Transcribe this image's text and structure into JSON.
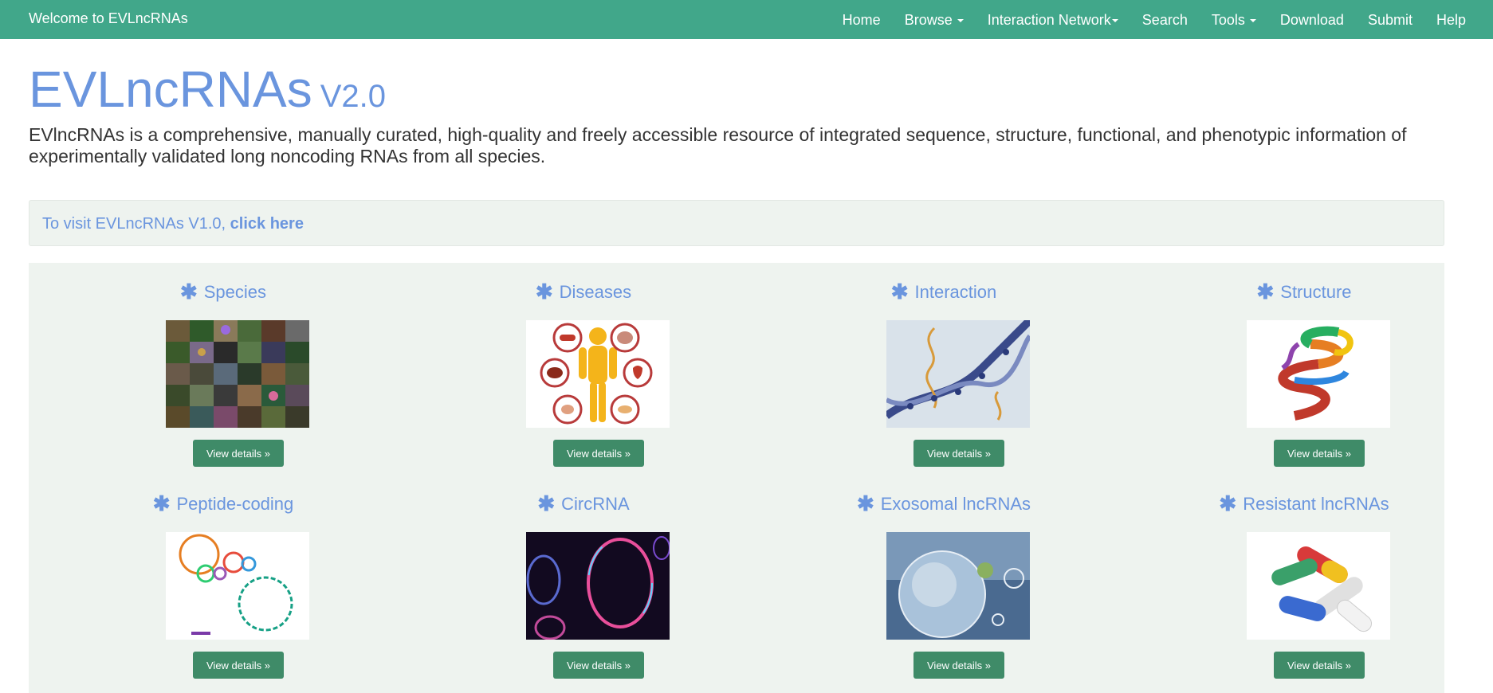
{
  "navbar": {
    "brand": "Welcome to EVLncRNAs",
    "items": [
      {
        "label": "Home"
      },
      {
        "label": "Browse"
      },
      {
        "label": "Interaction Network"
      },
      {
        "label": "Search"
      },
      {
        "label": "Tools"
      },
      {
        "label": "Download"
      },
      {
        "label": "Submit"
      },
      {
        "label": "Help"
      }
    ]
  },
  "header": {
    "title": "EVLncRNAs",
    "version": "V2.0",
    "description": "EVlncRNAs is a comprehensive, manually curated, high-quality and freely accessible resource of integrated sequence, structure, functional, and phenotypic information of experimentally validated long noncoding RNAs from all species."
  },
  "notice": {
    "prefix": "To visit EVLncRNAs V1.0, ",
    "link": "click here"
  },
  "categories": [
    {
      "title": "Species",
      "button": "View details »"
    },
    {
      "title": "Diseases",
      "button": "View details »"
    },
    {
      "title": "Interaction",
      "button": "View details »"
    },
    {
      "title": "Structure",
      "button": "View details »"
    },
    {
      "title": "Peptide-coding",
      "button": "View details »"
    },
    {
      "title": "CircRNA",
      "button": "View details »"
    },
    {
      "title": "Exosomal lncRNAs",
      "button": "View details »"
    },
    {
      "title": "Resistant lncRNAs",
      "button": "View details »"
    }
  ],
  "colors": {
    "navbar": "#41a78a",
    "accent_text": "#6a95de",
    "button": "#3f8b68",
    "panel": "#eef3ef"
  }
}
